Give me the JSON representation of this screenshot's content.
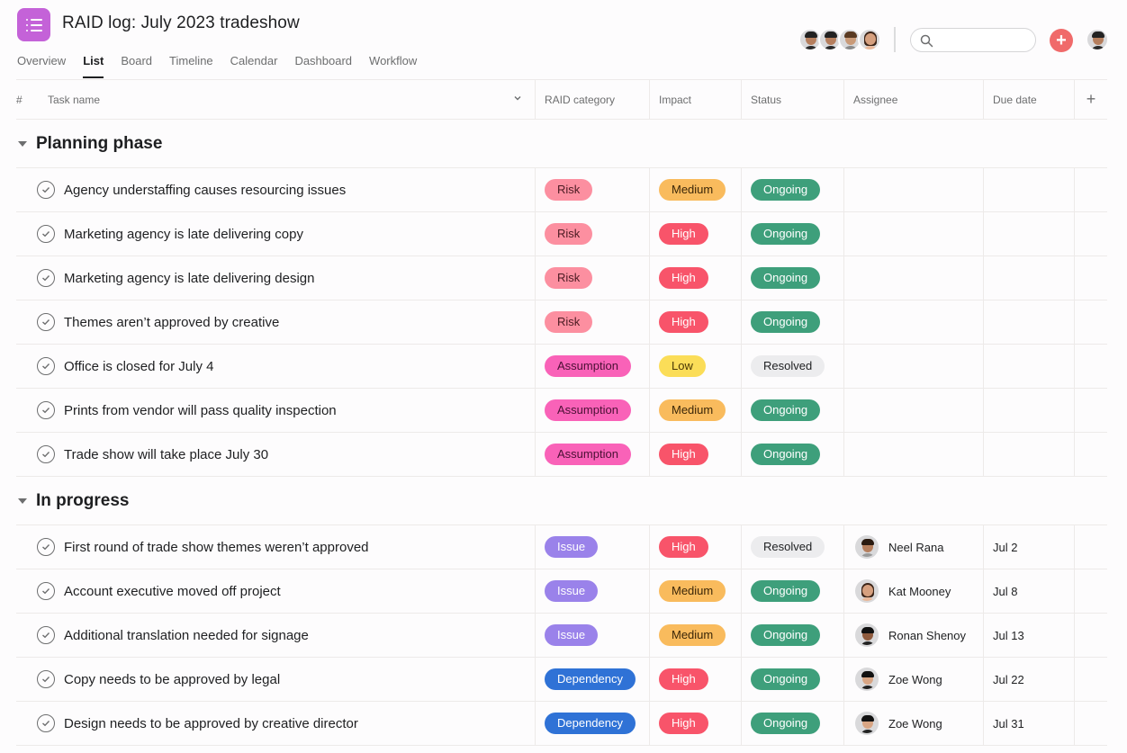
{
  "project": {
    "title": "RAID log: July 2023 tradeshow",
    "icon": "list-icon",
    "icon_color": "#c462d8"
  },
  "tabs": [
    {
      "label": "Overview",
      "active": false
    },
    {
      "label": "List",
      "active": true
    },
    {
      "label": "Board",
      "active": false
    },
    {
      "label": "Timeline",
      "active": false
    },
    {
      "label": "Calendar",
      "active": false
    },
    {
      "label": "Dashboard",
      "active": false
    },
    {
      "label": "Workflow",
      "active": false
    }
  ],
  "toolbar": {
    "search_placeholder": "",
    "add_button": "+",
    "add_color": "#f06a6a",
    "member_count": 4
  },
  "columns": {
    "hash": "#",
    "task_name": "Task name",
    "raid_category": "RAID category",
    "impact": "Impact",
    "status": "Status",
    "assignee": "Assignee",
    "due_date": "Due date",
    "add_column": "+"
  },
  "colors": {
    "Risk": {
      "bg": "#fc8fa0",
      "fg": "#4a1b22"
    },
    "Assumption": {
      "bg": "#f962b8",
      "fg": "#4a1034"
    },
    "Issue": {
      "bg": "#9a82ea",
      "fg": "#ffffff"
    },
    "Dependency": {
      "bg": "#2f72d6",
      "fg": "#ffffff"
    },
    "Medium": {
      "bg": "#f9bb5d",
      "fg": "#3a2608"
    },
    "High": {
      "bg": "#f8546a",
      "fg": "#ffffff"
    },
    "Low": {
      "bg": "#fbdd58",
      "fg": "#4a3806"
    },
    "Ongoing": {
      "bg": "#3e9f7b",
      "fg": "#ffffff"
    },
    "Resolved": {
      "bg": "#ececee",
      "fg": "#1e1f21"
    }
  },
  "sections": [
    {
      "title": "Planning phase",
      "rows": [
        {
          "task": "Agency understaffing causes resourcing issues",
          "category": "Risk",
          "impact": "Medium",
          "status": "Ongoing",
          "assignee": "",
          "due": ""
        },
        {
          "task": "Marketing agency is late delivering copy",
          "category": "Risk",
          "impact": "High",
          "status": "Ongoing",
          "assignee": "",
          "due": ""
        },
        {
          "task": "Marketing agency is late delivering design",
          "category": "Risk",
          "impact": "High",
          "status": "Ongoing",
          "assignee": "",
          "due": ""
        },
        {
          "task": "Themes aren’t approved by creative",
          "category": "Risk",
          "impact": "High",
          "status": "Ongoing",
          "assignee": "",
          "due": ""
        },
        {
          "task": "Office is closed for July 4",
          "category": "Assumption",
          "impact": "Low",
          "status": "Resolved",
          "assignee": "",
          "due": ""
        },
        {
          "task": "Prints from vendor will pass quality inspection",
          "category": "Assumption",
          "impact": "Medium",
          "status": "Ongoing",
          "assignee": "",
          "due": ""
        },
        {
          "task": "Trade show will take place July 30",
          "category": "Assumption",
          "impact": "High",
          "status": "Ongoing",
          "assignee": "",
          "due": ""
        }
      ]
    },
    {
      "title": "In progress",
      "rows": [
        {
          "task": "First round of trade show themes weren’t approved",
          "category": "Issue",
          "impact": "High",
          "status": "Resolved",
          "assignee": "Neel Rana",
          "due": "Jul 2"
        },
        {
          "task": "Account executive moved off project",
          "category": "Issue",
          "impact": "Medium",
          "status": "Ongoing",
          "assignee": "Kat Mooney",
          "due": "Jul 8"
        },
        {
          "task": "Additional translation needed for signage",
          "category": "Issue",
          "impact": "Medium",
          "status": "Ongoing",
          "assignee": "Ronan Shenoy",
          "due": "Jul 13"
        },
        {
          "task": "Copy needs to be approved by legal",
          "category": "Dependency",
          "impact": "High",
          "status": "Ongoing",
          "assignee": "Zoe Wong",
          "due": "Jul 22"
        },
        {
          "task": "Design needs to be approved by creative director",
          "category": "Dependency",
          "impact": "High",
          "status": "Ongoing",
          "assignee": "Zoe Wong",
          "due": "Jul 31"
        }
      ]
    }
  ]
}
